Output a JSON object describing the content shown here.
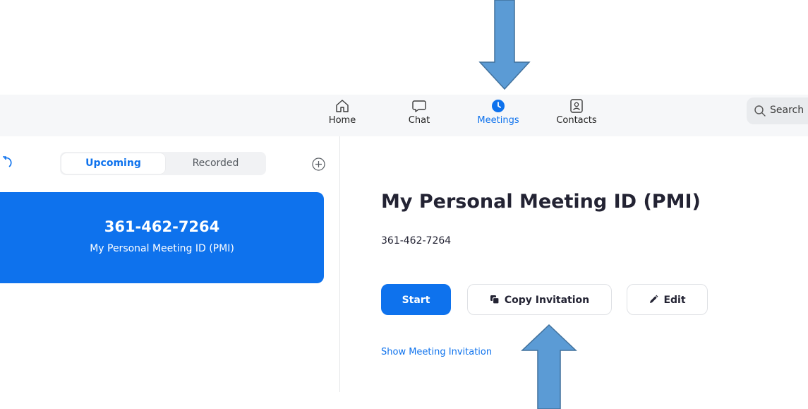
{
  "colors": {
    "accent": "#0e72ed",
    "nav_background": "#f6f7f9",
    "annotation_arrow": "#5b9bd5"
  },
  "nav": {
    "items": [
      {
        "label": "Home",
        "icon": "home-icon"
      },
      {
        "label": "Chat",
        "icon": "chat-bubble-icon"
      },
      {
        "label": "Meetings",
        "icon": "clock-icon",
        "active": true
      },
      {
        "label": "Contacts",
        "icon": "contact-card-icon"
      }
    ],
    "search_label": "Search"
  },
  "sidebar": {
    "tabs": [
      {
        "label": "Upcoming",
        "selected": true
      },
      {
        "label": "Recorded",
        "selected": false
      }
    ],
    "meeting_card": {
      "id": "361-462-7264",
      "name": "My Personal Meeting ID (PMI)"
    }
  },
  "detail": {
    "title": "My Personal Meeting ID (PMI)",
    "meeting_id": "361-462-7264",
    "start_label": "Start",
    "copy_label": "Copy Invitation",
    "edit_label": "Edit",
    "show_invitation_label": "Show Meeting Invitation"
  }
}
